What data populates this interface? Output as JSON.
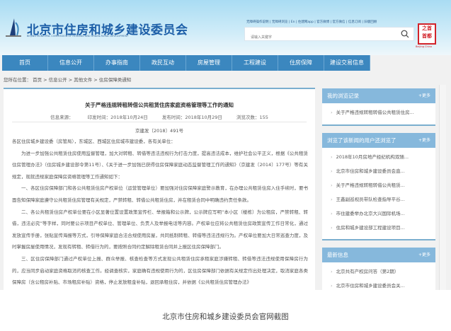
{
  "header": {
    "title": "北京市住房和城乡建设委员会",
    "subtitle": "BEIJING MUNICIPAL COMMISSION OF HOUSING AND URBAN-RURAL DEVELOPMENT",
    "top_links": "无障碍操作说明 | 无障碍浏览 | En | 住建网app | 官方微博 | 官方微信 | 信息订阅 | 旧版回顾",
    "search_placeholder": "请输入关键字",
    "seal_text": "之首都",
    "seal_en": "Beijing China"
  },
  "nav": [
    "首页",
    "信息公开",
    "办事指南",
    "政民互动",
    "房屋管理",
    "工程建设",
    "住房保障",
    "建设交易信息"
  ],
  "breadcrumb": "您所在位置： 首页 > 信息公开 > 其他文件 > 住房保障类通知",
  "article": {
    "title": "关于严格违规转租转借公共租赁住房家庭资格管理等工作的通知",
    "source": "信息来源：",
    "print_date": "印发时间：2018年10月24日",
    "publish_date": "发布时间：2018年10月29日",
    "views": "浏览次数：155",
    "doc_no": "京建发〔2018〕491号",
    "paragraphs": [
      "各区住房城乡建设委（房管局），东城区、西城区住房城市建设委，各有关单位：",
      "为进一步加强公共租赁住房使用监督管理，加大对转租、转借等违法违规行为打击力度，提高违法成本，维护社会公平正义，根据《公共租赁住房管理办法》（住房城乡建设部令第11号）、《关于进一步加强已获得住房保障家庭动态监督管理工作的通知》（京建发〔2014〕177号）等有关规定，现就违规家庭保障房资格管理等工作通知如下：",
      "一、各区住房保障部门和各公共租赁住房产权单位（运营管理单位）要加强对住房保障家庭警示教育，在办理公共租赁住房入住手续时，要书面告知保障家庭遵守公共租赁住房管理有关规定，严禁转租、转借公共租赁住房，并在租赁合同中明确违约责任条款。",
      "二、各公共租赁住房产权单位要在小区显著位置设置政策宣传栏、举报箱和公示牌，公示牌应写明“本小区（楼栋）为公租房，严禁转租、转借，违法必究”等字样，同时要公示项目产权单位、管理单位、负责人及举报电话等内容。产权单位应将公共租赁住房政策宣传工作日常化，通过发放宣传手册，张贴宣传海报等方式，引导保障家庭合法合规使用房屋，共同抵制转租、转借等违法违规行为。产权单位要加大日常巡查力度，及时掌握房屋使用情况，发现有转租、转借行为的，要按照合同约定解除租赁合同并上报区住房保障部门。",
      "三、区住房保障部门通过产权单位上报、群众举报、核查检查等方式发现公共租赁住房承租家庭涉嫌转租、转借等违法违规使用保障房行为的，应当同步启动家庭资格取消的核查工作。经调查核实，家庭确有违规使用行为的，区住房保障部门依据有关规定作出处理决定，取消家庭各类保障房（含公租房补贴、市场租房补贴）资格，停止发放租金补贴，退回承租住房，并依据《公共租赁住房管理办法》"
    ]
  },
  "sidebar": [
    {
      "title": "我的浏览记录",
      "more": "+更多",
      "items": [
        "关于严格违规转租转借公共租赁住房..."
      ]
    },
    {
      "title": "浏览了该新闻的用户还浏览了",
      "more": "+更多",
      "items": [
        "2018年10月房地产经纪机构双随...",
        "北京市住房和城乡建设委员会直...",
        "关于严格违规转租转借公共租赁...",
        "王鑫副巡视员带队检查指导平谷...",
        "市住建委举办北京大兴国际机场...",
        "住房和城乡建设部工程建设项目..."
      ]
    },
    {
      "title": "最新信息",
      "more": "+更多",
      "items": [
        "北京共有产权房问答（第2期）",
        "北京市住房和城乡建设委员会关..."
      ]
    }
  ],
  "caption": "北京市住房和城乡建设委员会官网截图",
  "colors": {
    "nav": "#3b87bf",
    "panel_header": "#86b8dc",
    "title": "#1d5fa8",
    "seal": "#d2232a"
  }
}
